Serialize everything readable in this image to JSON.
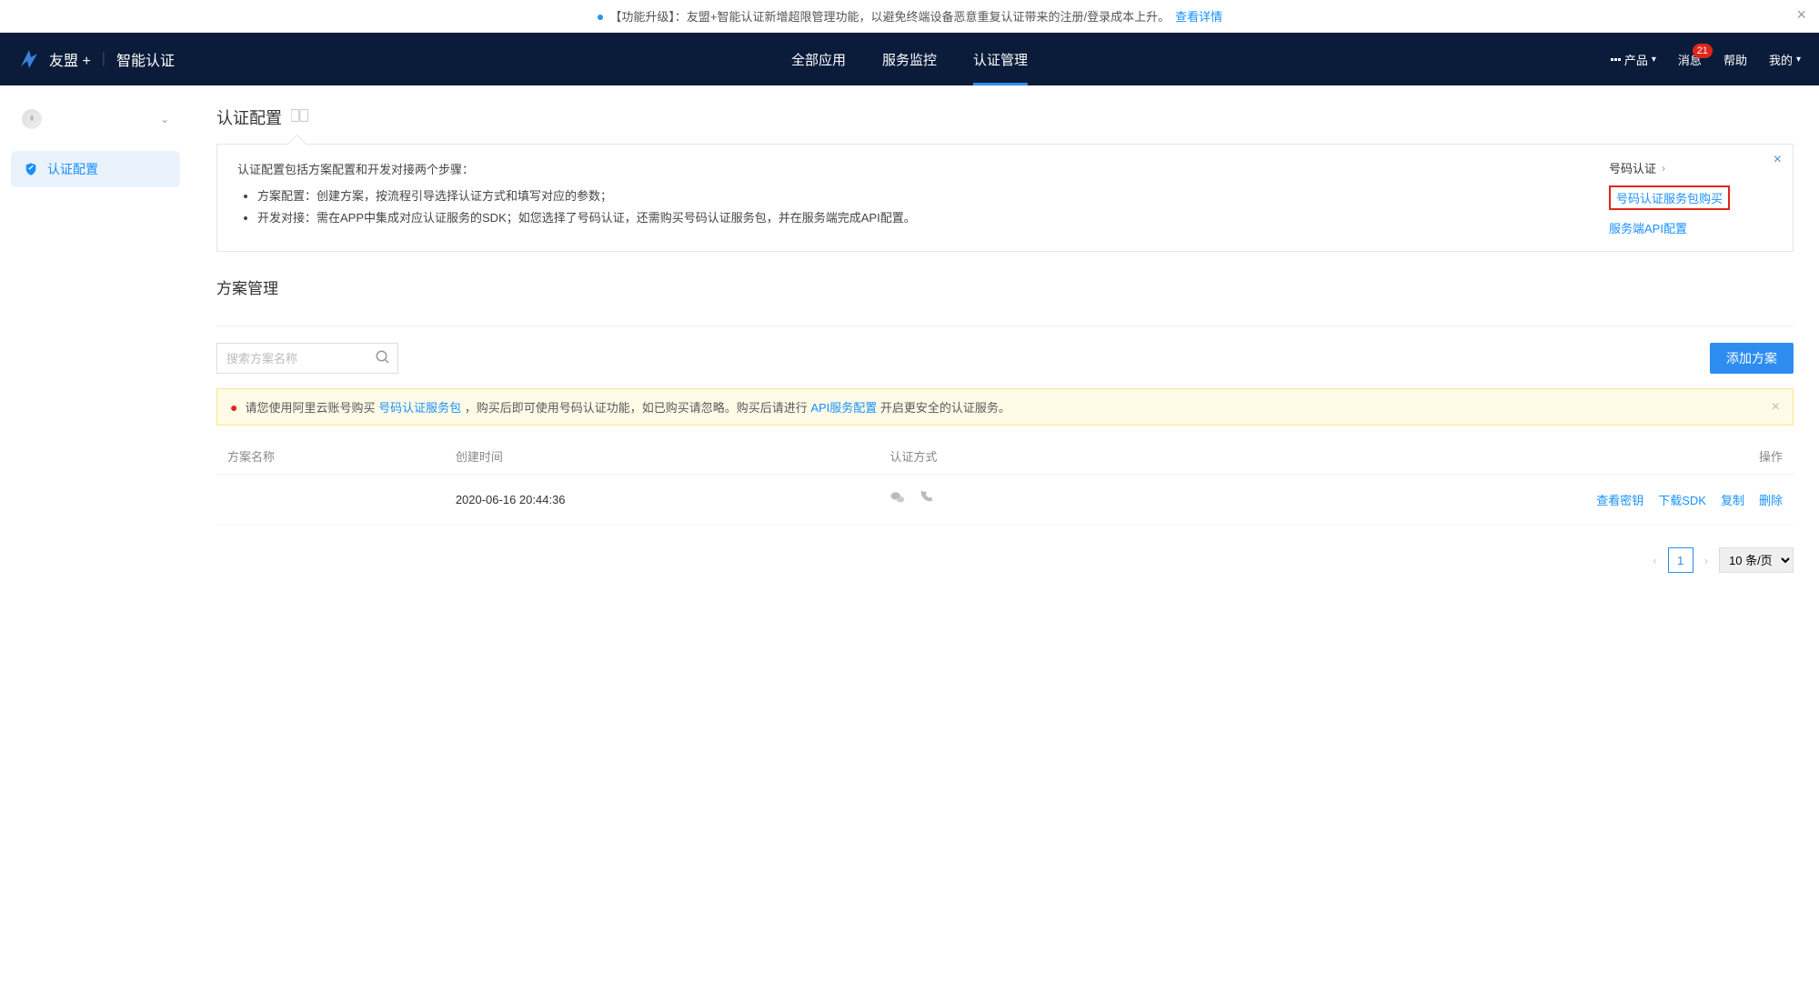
{
  "banner": {
    "prefix": "【功能升级】：",
    "text": "友盟+智能认证新增超限管理功能，以避免终端设备恶意重复认证带来的注册/登录成本上升。",
    "link": "查看详情"
  },
  "header": {
    "brand1": "友盟 +",
    "brand2": "智能认证",
    "tabs": [
      "全部应用",
      "服务监控",
      "认证管理"
    ],
    "active_tab": 2,
    "products": "产品",
    "messages": "消息",
    "msg_badge": "21",
    "help": "帮助",
    "mine": "我的"
  },
  "sidebar": {
    "app_name": "",
    "menu": {
      "auth_config": "认证配置"
    }
  },
  "page": {
    "title": "认证配置",
    "info": {
      "intro": "认证配置包括方案配置和开发对接两个步骤：",
      "bullet1": "方案配置：创建方案，按流程引导选择认证方式和填写对应的参数；",
      "bullet2": "开发对接：需在APP中集成对应认证服务的SDK；如您选择了号码认证，还需购买号码认证服务包，并在服务端完成API配置。",
      "right_title": "号码认证",
      "right_link1": "号码认证服务包购买",
      "right_link2": "服务端API配置"
    },
    "section_title": "方案管理",
    "search_placeholder": "搜索方案名称",
    "add_btn": "添加方案",
    "alert": {
      "pre": "请您使用阿里云账号购买 ",
      "link1": "号码认证服务包",
      "mid": " ，购买后即可使用号码认证功能，如已购买请忽略。购买后请进行 ",
      "link2": "API服务配置",
      "post": " 开启更安全的认证服务。"
    },
    "table": {
      "cols": {
        "name": "方案名称",
        "time": "创建时间",
        "auth": "认证方式",
        "ops": "操作"
      },
      "rows": [
        {
          "name": "",
          "time": "2020-06-16 20:44:36",
          "auth": [
            "wechat",
            "phone"
          ]
        }
      ],
      "actions": {
        "view_key": "查看密钥",
        "download_sdk": "下载SDK",
        "copy": "复制",
        "delete": "删除"
      }
    },
    "pagination": {
      "current": "1",
      "per_page": "10 条/页"
    }
  }
}
